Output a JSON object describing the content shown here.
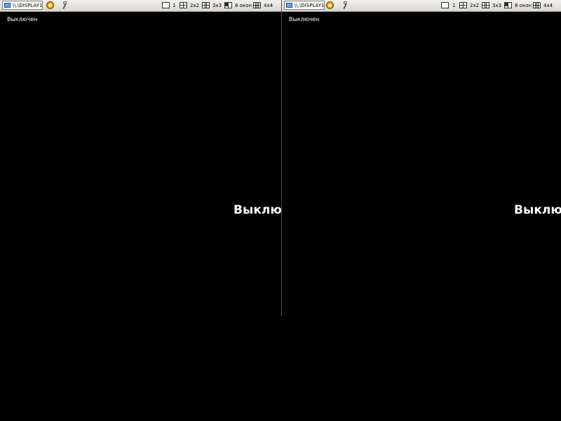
{
  "panes": [
    {
      "display_label": "\\\\.\\DISPLAY1",
      "layouts": [
        {
          "label": "1",
          "icon": "layout-single-icon"
        },
        {
          "label": "2x2",
          "icon": "layout-2x2-icon"
        },
        {
          "label": "3x3",
          "icon": "layout-3x3-icon"
        },
        {
          "label": "8 окон",
          "icon": "layout-8-icon"
        },
        {
          "label": "4x4",
          "icon": "layout-4x4-icon"
        }
      ],
      "status_small": "Выключен",
      "status_big": "Выключен"
    },
    {
      "display_label": "\\\\.\\DISPLAY1",
      "layouts": [
        {
          "label": "1",
          "icon": "layout-single-icon"
        },
        {
          "label": "2x2",
          "icon": "layout-2x2-icon"
        },
        {
          "label": "3x3",
          "icon": "layout-3x3-icon"
        },
        {
          "label": "8 окон",
          "icon": "layout-8-icon"
        },
        {
          "label": "4x4",
          "icon": "layout-4x4-icon"
        }
      ],
      "status_small": "Выключен",
      "status_big": "Выключен"
    }
  ],
  "colors": {
    "background": "#000000",
    "toolbar": "#e6e4dc",
    "text": "#ffffff"
  }
}
